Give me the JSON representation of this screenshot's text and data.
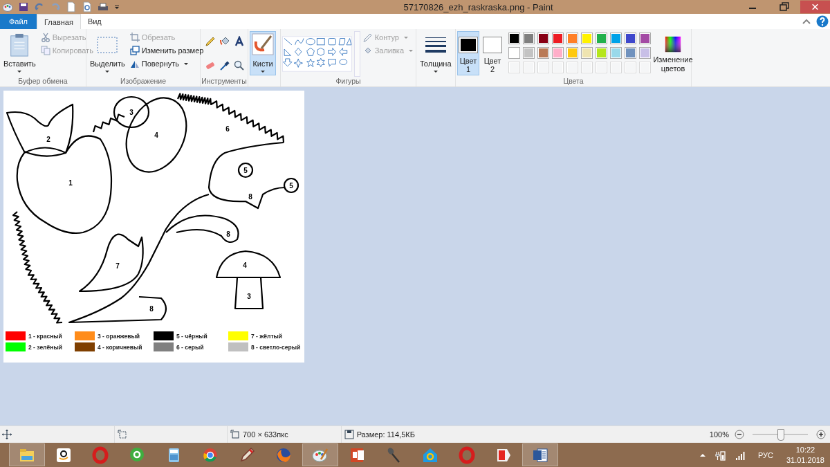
{
  "window": {
    "title": "57170826_ezh_raskraska.png - Paint"
  },
  "tabs": [
    {
      "label": "Файл",
      "kind": "file",
      "selected": false
    },
    {
      "label": "Главная",
      "kind": "tab",
      "selected": true
    },
    {
      "label": "Вид",
      "kind": "tab",
      "selected": false
    }
  ],
  "clipboard": {
    "label": "Буфер обмена",
    "paste": "Вставить",
    "cut": {
      "label": "Вырезать",
      "disabled": true
    },
    "copy": {
      "label": "Копировать",
      "disabled": true
    }
  },
  "image": {
    "label": "Изображение",
    "select": "Выделить",
    "crop": {
      "label": "Обрезать",
      "disabled": true
    },
    "resize": {
      "label": "Изменить размер",
      "disabled": false
    },
    "rotate": {
      "label": "Повернуть",
      "disabled": false
    }
  },
  "tools": {
    "label": "Инструменты"
  },
  "brushes": {
    "label": "Кисти",
    "selected": true
  },
  "shapes": {
    "label": "Фигуры",
    "outline": {
      "label": "Контур",
      "disabled": true
    },
    "fill": {
      "label": "Заливка",
      "disabled": true
    }
  },
  "thickness": {
    "label": "Толщина"
  },
  "colors": {
    "label": "Цвета",
    "color1": {
      "label": "Цвет",
      "number": "1",
      "color": "#000000",
      "selected": true
    },
    "color2": {
      "label": "Цвет",
      "number": "2",
      "color": "#ffffff",
      "selected": false
    },
    "palette": [
      {
        "color": "#000000"
      },
      {
        "color": "#7f7f7f"
      },
      {
        "color": "#880015"
      },
      {
        "color": "#ed1c24"
      },
      {
        "color": "#ff7f27"
      },
      {
        "color": "#fff200"
      },
      {
        "color": "#22b14c"
      },
      {
        "color": "#00a2e8"
      },
      {
        "color": "#3f48cc"
      },
      {
        "color": "#a349a4"
      },
      {
        "color": "#ffffff"
      },
      {
        "color": "#c3c3c3"
      },
      {
        "color": "#b97a57"
      },
      {
        "color": "#ffaec9"
      },
      {
        "color": "#ffc90e"
      },
      {
        "color": "#efe4b0"
      },
      {
        "color": "#b5e61d"
      },
      {
        "color": "#99d9ea"
      },
      {
        "color": "#7092be"
      },
      {
        "color": "#c8bfe7"
      }
    ],
    "edit_colors": "Изменение цветов"
  },
  "drawing": {
    "labels": [
      "3",
      "6",
      "2",
      "4",
      "5",
      "5",
      "1",
      "8",
      "8",
      "7",
      "4",
      "3",
      "8"
    ],
    "legend": [
      {
        "label": "1 - красный",
        "color": "#ff0000"
      },
      {
        "label": "3 - оранжевый",
        "color": "#ff8c1a"
      },
      {
        "label": "5 - чёрный",
        "color": "#000000"
      },
      {
        "label": "7 - жёлтый",
        "color": "#ffff00"
      },
      {
        "label": "2 - зелёный",
        "color": "#00ff00"
      },
      {
        "label": "4 - коричневый",
        "color": "#7f3f00"
      },
      {
        "label": "6 - серый",
        "color": "#808080"
      },
      {
        "label": "8 - светло-серый",
        "color": "#c0c0c0"
      }
    ]
  },
  "status_bar": {
    "dimensions": "700 × 633пкс",
    "size": "Размер: 114,5КБ",
    "zoom": "100%",
    "zoom_slider": {
      "level": 0.5
    }
  },
  "taskbar": {
    "apps": [
      {
        "kind": "folder",
        "running": true
      },
      {
        "kind": "smile-box",
        "running": false
      },
      {
        "kind": "ring",
        "running": false
      },
      {
        "kind": "at-bubble",
        "running": false
      },
      {
        "kind": "calculator",
        "running": false
      },
      {
        "kind": "browser-circle",
        "running": false
      },
      {
        "kind": "pencil",
        "running": false
      },
      {
        "kind": "fox",
        "running": false
      },
      {
        "kind": "palette",
        "running": true
      },
      {
        "kind": "slides",
        "running": false
      },
      {
        "kind": "microphone",
        "running": false
      },
      {
        "kind": "at-house",
        "running": false
      },
      {
        "kind": "ring",
        "running": false
      },
      {
        "kind": "flag-shape",
        "running": false
      },
      {
        "kind": "document",
        "running": true
      }
    ],
    "language": "РУС",
    "time": "10:22",
    "date": "31.01.2018"
  }
}
